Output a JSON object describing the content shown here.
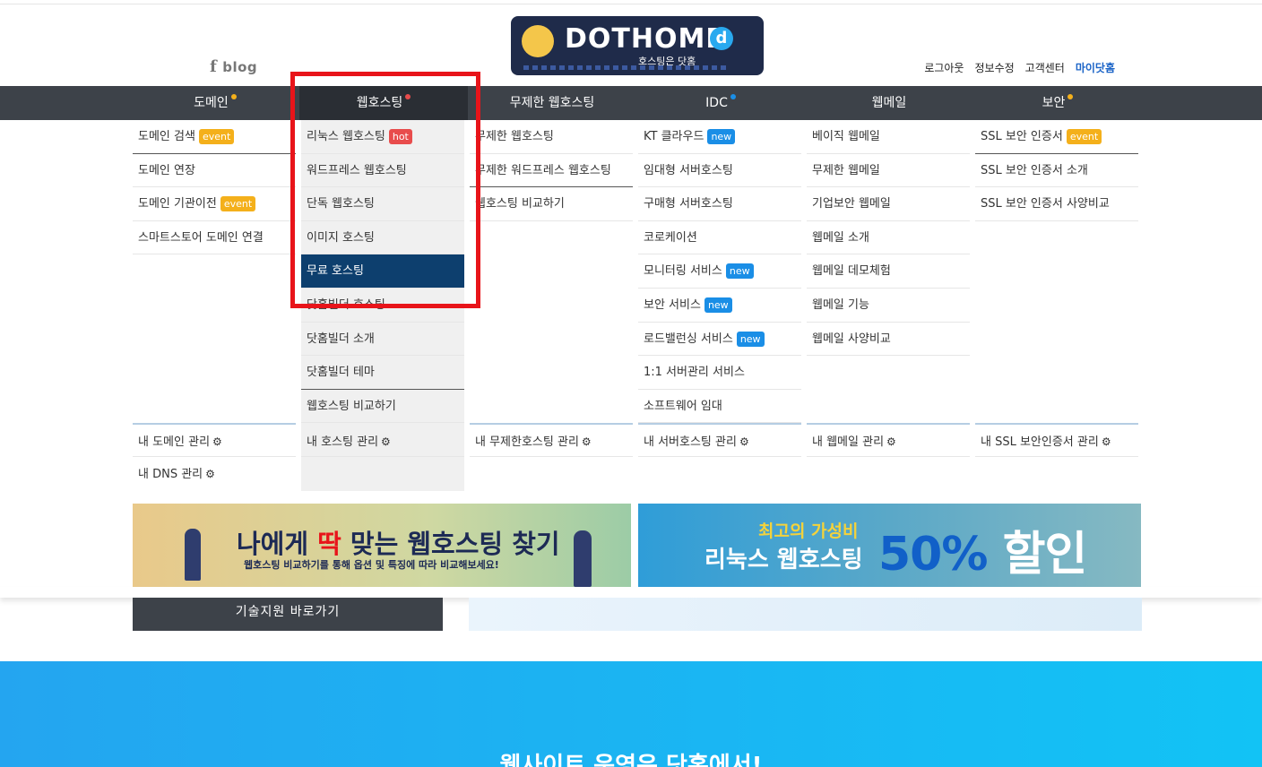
{
  "header": {
    "blog_label": "blog",
    "logo_title": "DOTHOME",
    "logo_d": "d",
    "logo_sub": "호스팅은 닷홈",
    "util": {
      "logout": "로그아웃",
      "edit_info": "정보수정",
      "support": "고객센터",
      "myhome": "마이닷홈"
    }
  },
  "gnb": [
    {
      "label": "도메인",
      "dot": "#f4b01b"
    },
    {
      "label": "웹호스팅",
      "dot": "#e84c4c"
    },
    {
      "label": "무제한 웹호스팅",
      "dot": ""
    },
    {
      "label": "IDC",
      "dot": "#1a8ee6"
    },
    {
      "label": "웹메일",
      "dot": ""
    },
    {
      "label": "보안",
      "dot": "#f4b01b"
    }
  ],
  "menu": {
    "domain": [
      {
        "label": "도메인 검색",
        "badge": "event"
      },
      {
        "label": "도메인 연장",
        "badge": ""
      },
      {
        "label": "도메인 기관이전",
        "badge": "event"
      },
      {
        "label": "스마트스토어 도메인 연결",
        "badge": ""
      }
    ],
    "hosting": [
      {
        "label": "리눅스 웹호스팅",
        "badge": "hot"
      },
      {
        "label": "워드프레스 웹호스팅",
        "badge": ""
      },
      {
        "label": "단독 웹호스팅",
        "badge": ""
      },
      {
        "label": "이미지 호스팅",
        "badge": ""
      },
      {
        "label": "무료 호스팅",
        "badge": ""
      },
      {
        "label": "닷홈빌더 호스팅",
        "badge": ""
      },
      {
        "label": "닷홈빌더 소개",
        "badge": ""
      },
      {
        "label": "닷홈빌더 테마",
        "badge": ""
      },
      {
        "label": "웹호스팅 비교하기",
        "badge": ""
      }
    ],
    "unlimited": [
      {
        "label": "무제한 웹호스팅",
        "badge": ""
      },
      {
        "label": "무제한 워드프레스 웹호스팅",
        "badge": ""
      },
      {
        "label": "웹호스팅 비교하기",
        "badge": ""
      }
    ],
    "idc": [
      {
        "label": "KT 클라우드",
        "badge": "new"
      },
      {
        "label": "임대형 서버호스팅",
        "badge": ""
      },
      {
        "label": "구매형 서버호스팅",
        "badge": ""
      },
      {
        "label": "코로케이션",
        "badge": ""
      },
      {
        "label": "모니터링 서비스",
        "badge": "new"
      },
      {
        "label": "보안 서비스",
        "badge": "new"
      },
      {
        "label": "로드밸런싱 서비스",
        "badge": "new"
      },
      {
        "label": "1:1 서버관리 서비스",
        "badge": ""
      },
      {
        "label": "소프트웨어 임대",
        "badge": ""
      }
    ],
    "webmail": [
      {
        "label": "베이직 웹메일",
        "badge": ""
      },
      {
        "label": "무제한 웹메일",
        "badge": ""
      },
      {
        "label": "기업보안 웹메일",
        "badge": ""
      },
      {
        "label": "웹메일 소개",
        "badge": ""
      },
      {
        "label": "웹메일 데모체험",
        "badge": ""
      },
      {
        "label": "웹메일 기능",
        "badge": ""
      },
      {
        "label": "웹메일 사양비교",
        "badge": ""
      }
    ],
    "security": [
      {
        "label": "SSL 보안 인증서",
        "badge": "event"
      },
      {
        "label": "SSL 보안 인증서 소개",
        "badge": ""
      },
      {
        "label": "SSL 보안 인증서 사양비교",
        "badge": ""
      }
    ],
    "manage": [
      "내 도메인 관리",
      "내 호스팅 관리",
      "내 무제한호스팅 관리",
      "내 서버호스팅 관리",
      "내 웹메일 관리",
      "내 SSL 보안인증서 관리"
    ],
    "dns": "내 DNS 관리"
  },
  "banner1": {
    "pre": "나에게 ",
    "red": "딱",
    "post": " 맞는 웹호스팅 찾기",
    "sub": "웹호스팅 비교하기를 통해 옵션 및 특징에 따라 비교해보세요!"
  },
  "banner2": {
    "a": "최고의 가성비",
    "b": "리눅스 웹호스팅",
    "c": "50%",
    "d": " 할인"
  },
  "tech_button": "기술지원 바로가기",
  "hero_title": "웹사이트 운영은 닷홈에서!"
}
